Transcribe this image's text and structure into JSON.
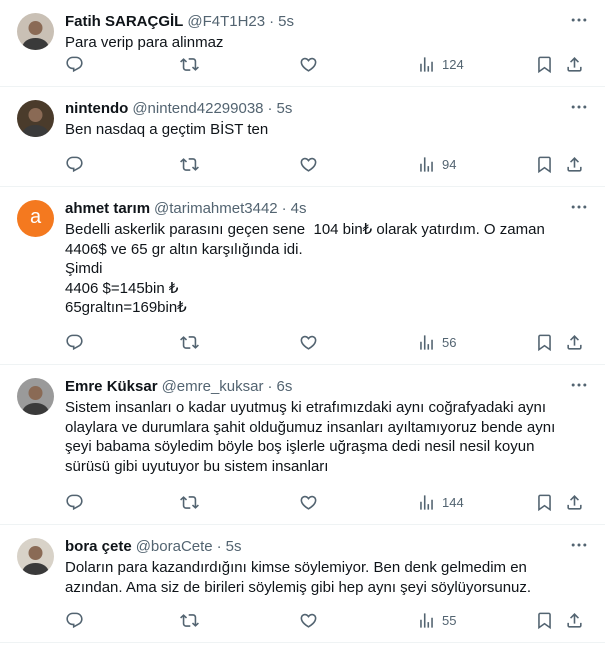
{
  "tweets": [
    {
      "name": "Fatih SARAÇGİL",
      "handle": "@F4T1H23",
      "dot": "·",
      "time": "5s",
      "text": "Para verip para alinmaz",
      "views": "124",
      "avatar_style": "photo",
      "avatar_color": "#c9c0b5"
    },
    {
      "name": "nintendo",
      "handle": "@nintend42299038",
      "dot": "·",
      "time": "5s",
      "text": "Ben nasdaq a geçtim BİST ten",
      "views": "94",
      "avatar_style": "photo",
      "avatar_color": "#4a3b2b"
    },
    {
      "name": "ahmet tarım",
      "handle": "@tarimahmet3442",
      "dot": "·",
      "time": "4s",
      "text": "Bedelli askerlik parasını geçen sene  104 bin₺ olarak yatırdım. O zaman\n4406$ ve 65 gr altın karşılığında idi.\nŞimdi\n4406 $=145bin ₺\n65graltın=169bin₺",
      "views": "56",
      "avatar_style": "letter",
      "avatar_letter": "a",
      "avatar_color": "#f4791f"
    },
    {
      "name": "Emre Küksar",
      "handle": "@emre_kuksar",
      "dot": "·",
      "time": "6s",
      "text": "Sistem insanları o kadar uyutmuş ki etrafımızdaki aynı coğrafyadaki aynı\nolaylara ve durumlara şahit olduğumuz insanları ayıltamıyoruz bende aynı\nşeyi babama söyledim böyle boş işlerle uğraşma dedi nesil nesil koyun\nsürüsü gibi uyutuyor bu sistem insanları",
      "views": "144",
      "avatar_style": "photo",
      "avatar_color": "#9a9a9a"
    },
    {
      "name": "bora çete",
      "handle": "@boraCete",
      "dot": "·",
      "time": "5s",
      "text": "Doların para kazandırdığını kimse söylemiyor. Ben denk gelmedim en\nazından. Ama siz de birileri söylemiş gibi hep aynı şeyi söylüyorsunuz.",
      "views": "55",
      "avatar_style": "photo",
      "avatar_color": "#d8d2c8"
    }
  ],
  "colors": {
    "text": "#0f1419",
    "muted": "#536471",
    "divider": "#eff3f4"
  }
}
